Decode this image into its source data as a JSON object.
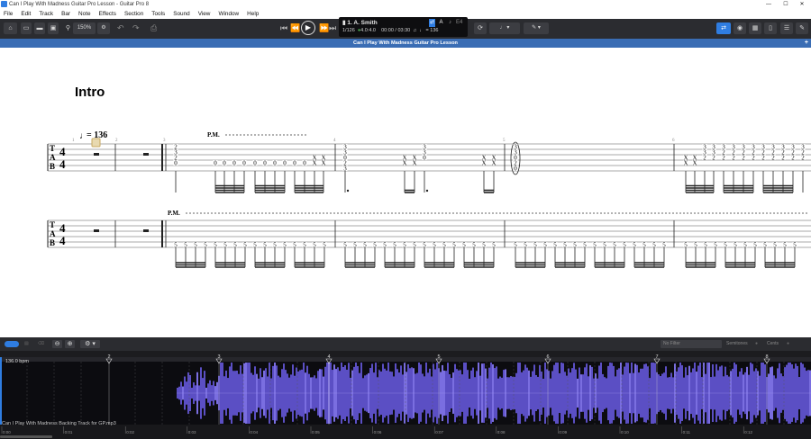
{
  "window": {
    "title": "Can I Play With Madness Guitar Pro Lesson - Guitar Pro 8",
    "minimize_icon": "minimize-icon",
    "maximize_icon": "maximize-icon",
    "close_icon": "close-icon"
  },
  "menu": [
    "File",
    "Edit",
    "Track",
    "Bar",
    "Note",
    "Effects",
    "Section",
    "Tools",
    "Sound",
    "View",
    "Window",
    "Help"
  ],
  "toolbar": {
    "zoom": "150%",
    "lcd": {
      "track": "1. A. Smith",
      "bar_position": "1/126",
      "time_signature": "4.0:4.0",
      "time": "00:00 / 03:30",
      "tempo": "= 136",
      "tuning_note": "E4"
    }
  },
  "document_tab": "Can I Play With Madness Guitar Pro Lesson",
  "score": {
    "section_title": "Intro",
    "tempo_marking": "= 136",
    "time_signature": {
      "top": "4",
      "bottom": "4"
    },
    "tab_clef": [
      "T",
      "A",
      "B"
    ],
    "palm_mute": "P.M.",
    "bar_numbers": [
      "1",
      "2",
      "3",
      "4",
      "5",
      "6"
    ],
    "staff1": {
      "bar3_chord": [
        "2",
        "3",
        "2",
        "0"
      ],
      "bar3_eighths": "0",
      "bar3_mutes": "X",
      "bar4_chord": [
        "3",
        "3",
        "0",
        "2",
        "3"
      ],
      "bar4_chord_b": [
        "3",
        "3",
        "0"
      ],
      "bar5_chord": [
        "3",
        "3",
        "0",
        "2",
        "0"
      ],
      "bar6_top": "3",
      "bar6_mid": "2"
    },
    "staff2": {
      "fret": "5"
    }
  },
  "bottom_toolbar": {
    "filter_placeholder": "No Filter",
    "semitones": "Semitones",
    "cents": "Cents"
  },
  "timeline": {
    "bpm": "136.0 bpm",
    "markers": [
      "2",
      "3",
      "4",
      "5",
      "6",
      "7",
      "8"
    ],
    "audio_track": "Can I Play With Madness Backing Track for GP.mp3",
    "time_ticks": [
      "0:00",
      "0:01",
      "0:02",
      "0:03",
      "0:04",
      "0:05",
      "0:06",
      "0:07",
      "0:08",
      "0:09",
      "0:10",
      "0:11",
      "0:12"
    ],
    "colors": {
      "waveform": "#5b4fc4",
      "waveform_bright": "#7a6ee0",
      "marker_line": "#cfcfcf"
    }
  }
}
